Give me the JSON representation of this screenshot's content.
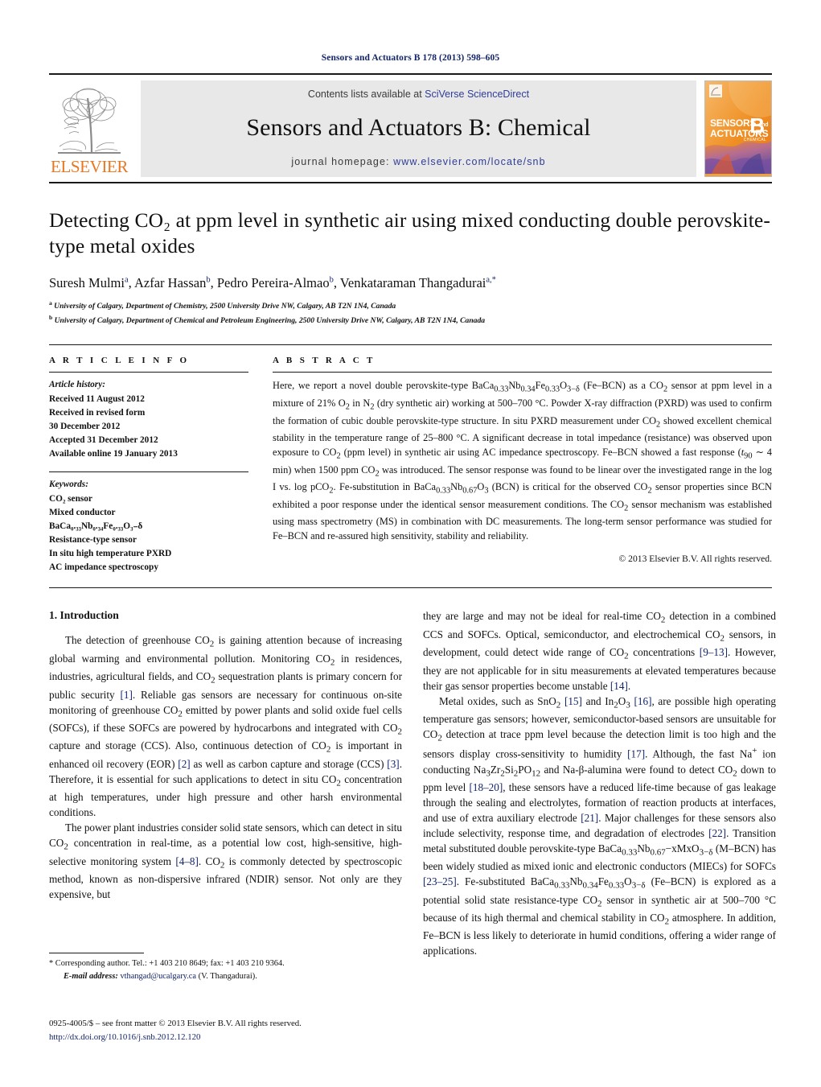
{
  "running_head": "Sensors and Actuators B 178 (2013) 598–605",
  "masthead": {
    "publisher_name": "ELSEVIER",
    "contents_prefix": "Contents lists available at ",
    "contents_link": "SciVerse ScienceDirect",
    "journal_title": "Sensors and Actuators B: Chemical",
    "homepage_prefix": "journal homepage: ",
    "homepage_url": "www.elsevier.com/locate/snb",
    "cover": {
      "line1": "SENSORS",
      "line1_and": "and",
      "line2": "ACTUATORS",
      "letter": "B",
      "subtitle": "CHEMICAL"
    }
  },
  "title": "Detecting CO₂ at ppm level in synthetic air using mixed conducting double perovskite-type metal oxides",
  "authors": [
    {
      "name": "Suresh Mulmi",
      "sup": "a"
    },
    {
      "name": "Azfar Hassan",
      "sup": "b"
    },
    {
      "name": "Pedro Pereira-Almao",
      "sup": "b"
    },
    {
      "name": "Venkataraman Thangadurai",
      "sup": "a,*"
    }
  ],
  "affiliations": [
    {
      "sup": "a",
      "text": "University of Calgary, Department of Chemistry, 2500 University Drive NW, Calgary, AB T2N 1N4, Canada"
    },
    {
      "sup": "b",
      "text": "University of Calgary, Department of Chemical and Petroleum Engineering, 2500 University Drive NW, Calgary, AB T2N 1N4, Canada"
    }
  ],
  "article_info": {
    "heading": "A R T I C L E   I N F O",
    "history_label": "Article history:",
    "history": [
      "Received 11 August 2012",
      "Received in revised form",
      "30 December 2012",
      "Accepted 31 December 2012",
      "Available online 19 January 2013"
    ],
    "keywords_label": "Keywords:",
    "keywords": [
      "CO₂ sensor",
      "Mixed conductor",
      "BaCa₀.₃₃Nb₀.₃₄Fe₀.₃₃O₃₋δ",
      "Resistance-type sensor",
      "In situ high temperature PXRD",
      "AC impedance spectroscopy"
    ]
  },
  "abstract": {
    "heading": "A B S T R A C T",
    "text": "Here, we report a novel double perovskite-type BaCa0.33Nb0.34Fe0.33O3−δ (Fe–BCN) as a CO2 sensor at ppm level in a mixture of 21% O2 in N2 (dry synthetic air) working at 500–700 °C. Powder X-ray diffraction (PXRD) was used to confirm the formation of cubic double perovskite-type structure. In situ PXRD measurement under CO2 showed excellent chemical stability in the temperature range of 25–800 °C. A significant decrease in total impedance (resistance) was observed upon exposure to CO2 (ppm level) in synthetic air using AC impedance spectroscopy. Fe–BCN showed a fast response (t90 ∼ 4 min) when 1500 ppm CO2 was introduced. The sensor response was found to be linear over the investigated range in the log I vs. log pCO2. Fe-substitution in BaCa0.33Nb0.67O3 (BCN) is critical for the observed CO2 sensor properties since BCN exhibited a poor response under the identical sensor measurement conditions. The CO2 sensor mechanism was established using mass spectrometry (MS) in combination with DC measurements. The long-term sensor performance was studied for Fe–BCN and re-assured high sensitivity, stability and reliability.",
    "copyright": "© 2013 Elsevier B.V. All rights reserved."
  },
  "introduction": {
    "heading": "1. Introduction",
    "left_paragraphs": [
      "The detection of greenhouse CO2 is gaining attention because of increasing global warming and environmental pollution. Monitoring CO2 in residences, industries, agricultural fields, and CO2 sequestration plants is primary concern for public security [1]. Reliable gas sensors are necessary for continuous on-site monitoring of greenhouse CO2 emitted by power plants and solid oxide fuel cells (SOFCs), if these SOFCs are powered by hydrocarbons and integrated with CO2 capture and storage (CCS). Also, continuous detection of CO2 is important in enhanced oil recovery (EOR) [2] as well as carbon capture and storage (CCS) [3]. Therefore, it is essential for such applications to detect in situ CO2 concentration at high temperatures, under high pressure and other harsh environmental conditions.",
      "The power plant industries consider solid state sensors, which can detect in situ CO2 concentration in real-time, as a potential low cost, high-sensitive, high-selective monitoring system [4–8]. CO2 is commonly detected by spectroscopic method, known as non-dispersive infrared (NDIR) sensor. Not only are they expensive, but"
    ],
    "right_paragraphs": [
      "they are large and may not be ideal for real-time CO2 detection in a combined CCS and SOFCs. Optical, semiconductor, and electrochemical CO2 sensors, in development, could detect wide range of CO2 concentrations [9–13]. However, they are not applicable for in situ measurements at elevated temperatures because their gas sensor properties become unstable [14].",
      "Metal oxides, such as SnO2 [15] and In2O3 [16], are possible high operating temperature gas sensors; however, semiconductor-based sensors are unsuitable for CO2 detection at trace ppm level because the detection limit is too high and the sensors display cross-sensitivity to humidity [17]. Although, the fast Na+ ion conducting Na3Zr2Si2PO12 and Na-β-alumina were found to detect CO2 down to ppm level [18–20], these sensors have a reduced life-time because of gas leakage through the sealing and electrolytes, formation of reaction products at interfaces, and use of extra auxiliary electrode [21]. Major challenges for these sensors also include selectivity, response time, and degradation of electrodes [22]. Transition metal substituted double perovskite-type BaCa0.33Nb0.67−xMxO3−δ (M–BCN) has been widely studied as mixed ionic and electronic conductors (MIECs) for SOFCs [23–25]. Fe-substituted BaCa0.33Nb0.34Fe0.33O3−δ (Fe–BCN) is explored as a potential solid state resistance-type CO2 sensor in synthetic air at 500–700 °C because of its high thermal and chemical stability in CO2 atmosphere. In addition, Fe–BCN is less likely to deteriorate in humid conditions, offering a wider range of applications."
    ]
  },
  "footnotes": {
    "corresponding": "* Corresponding author. Tel.: +1 403 210 8649; fax: +1 403 210 9364.",
    "email_label": "E-mail address:",
    "email": "vthangad@ucalgary.ca",
    "email_suffix": "(V. Thangadurai)."
  },
  "imprint": {
    "issn_line": "0925-4005/$ – see front matter © 2013 Elsevier B.V. All rights reserved.",
    "doi": "http://dx.doi.org/10.1016/j.snb.2012.12.120"
  },
  "colors": {
    "link_blue": "#12246b",
    "sciencedirect_blue": "#2f3d96",
    "elsevier_orange": "#e87722",
    "masthead_grey": "#e8e8e8"
  }
}
